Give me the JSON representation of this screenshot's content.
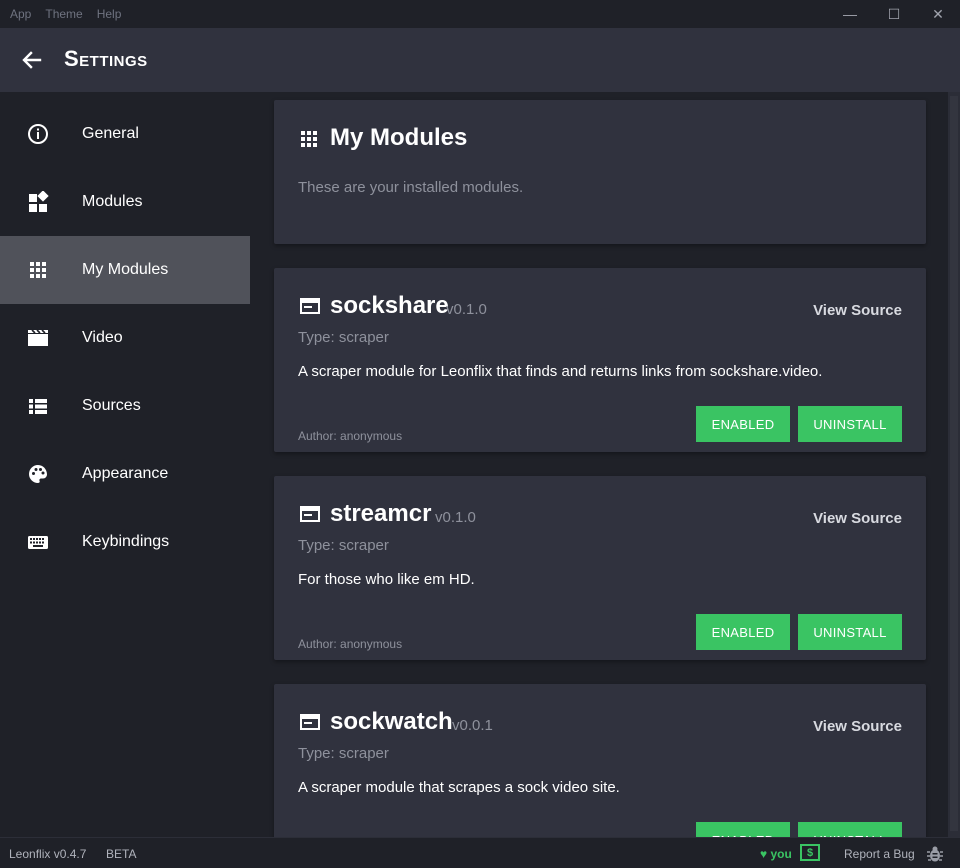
{
  "menubar": {
    "items": [
      "App",
      "Theme",
      "Help"
    ]
  },
  "window_controls": {
    "minimize": "—",
    "maximize": "☐",
    "close": "✕"
  },
  "header": {
    "title": "Settings"
  },
  "sidebar": {
    "items": [
      {
        "label": "General",
        "icon": "info-circle-icon",
        "active": false
      },
      {
        "label": "Modules",
        "icon": "widgets-icon",
        "active": false
      },
      {
        "label": "My Modules",
        "icon": "apps-grid-icon",
        "active": true
      },
      {
        "label": "Video",
        "icon": "clapperboard-icon",
        "active": false
      },
      {
        "label": "Sources",
        "icon": "list-icon",
        "active": false
      },
      {
        "label": "Appearance",
        "icon": "palette-icon",
        "active": false
      },
      {
        "label": "Keybindings",
        "icon": "keyboard-icon",
        "active": false
      }
    ]
  },
  "main": {
    "title": "My Modules",
    "subtitle": "These are your installed modules.",
    "modules": [
      {
        "name": "sockshare",
        "version": "v0.1.0",
        "type": "Type: scraper",
        "description": "A scraper module for Leonflix that finds and returns links from sockshare.video.",
        "author": "Author: anonymous",
        "view_source": "View Source",
        "enabled_label": "ENABLED",
        "uninstall_label": "UNINSTALL"
      },
      {
        "name": "streamcr",
        "version": "v0.1.0",
        "type": "Type: scraper",
        "description": "For those who like em HD.",
        "author": "Author: anonymous",
        "view_source": "View Source",
        "enabled_label": "ENABLED",
        "uninstall_label": "UNINSTALL"
      },
      {
        "name": "sockwatch",
        "version": "v0.0.1",
        "type": "Type: scraper",
        "description": "A scraper module that scrapes a sock video site.",
        "view_source": "View Source",
        "enabled_label": "ENABLED",
        "uninstall_label": "UNINSTALL"
      }
    ]
  },
  "footer": {
    "version": "Leonflix v0.4.7",
    "beta": "BETA",
    "heart": "♥ you",
    "donate": "$",
    "report": "Report a Bug"
  },
  "colors": {
    "accent": "#3ac463",
    "panel": "#30323e",
    "background": "#1f2128",
    "active_nav": "#50525a"
  }
}
